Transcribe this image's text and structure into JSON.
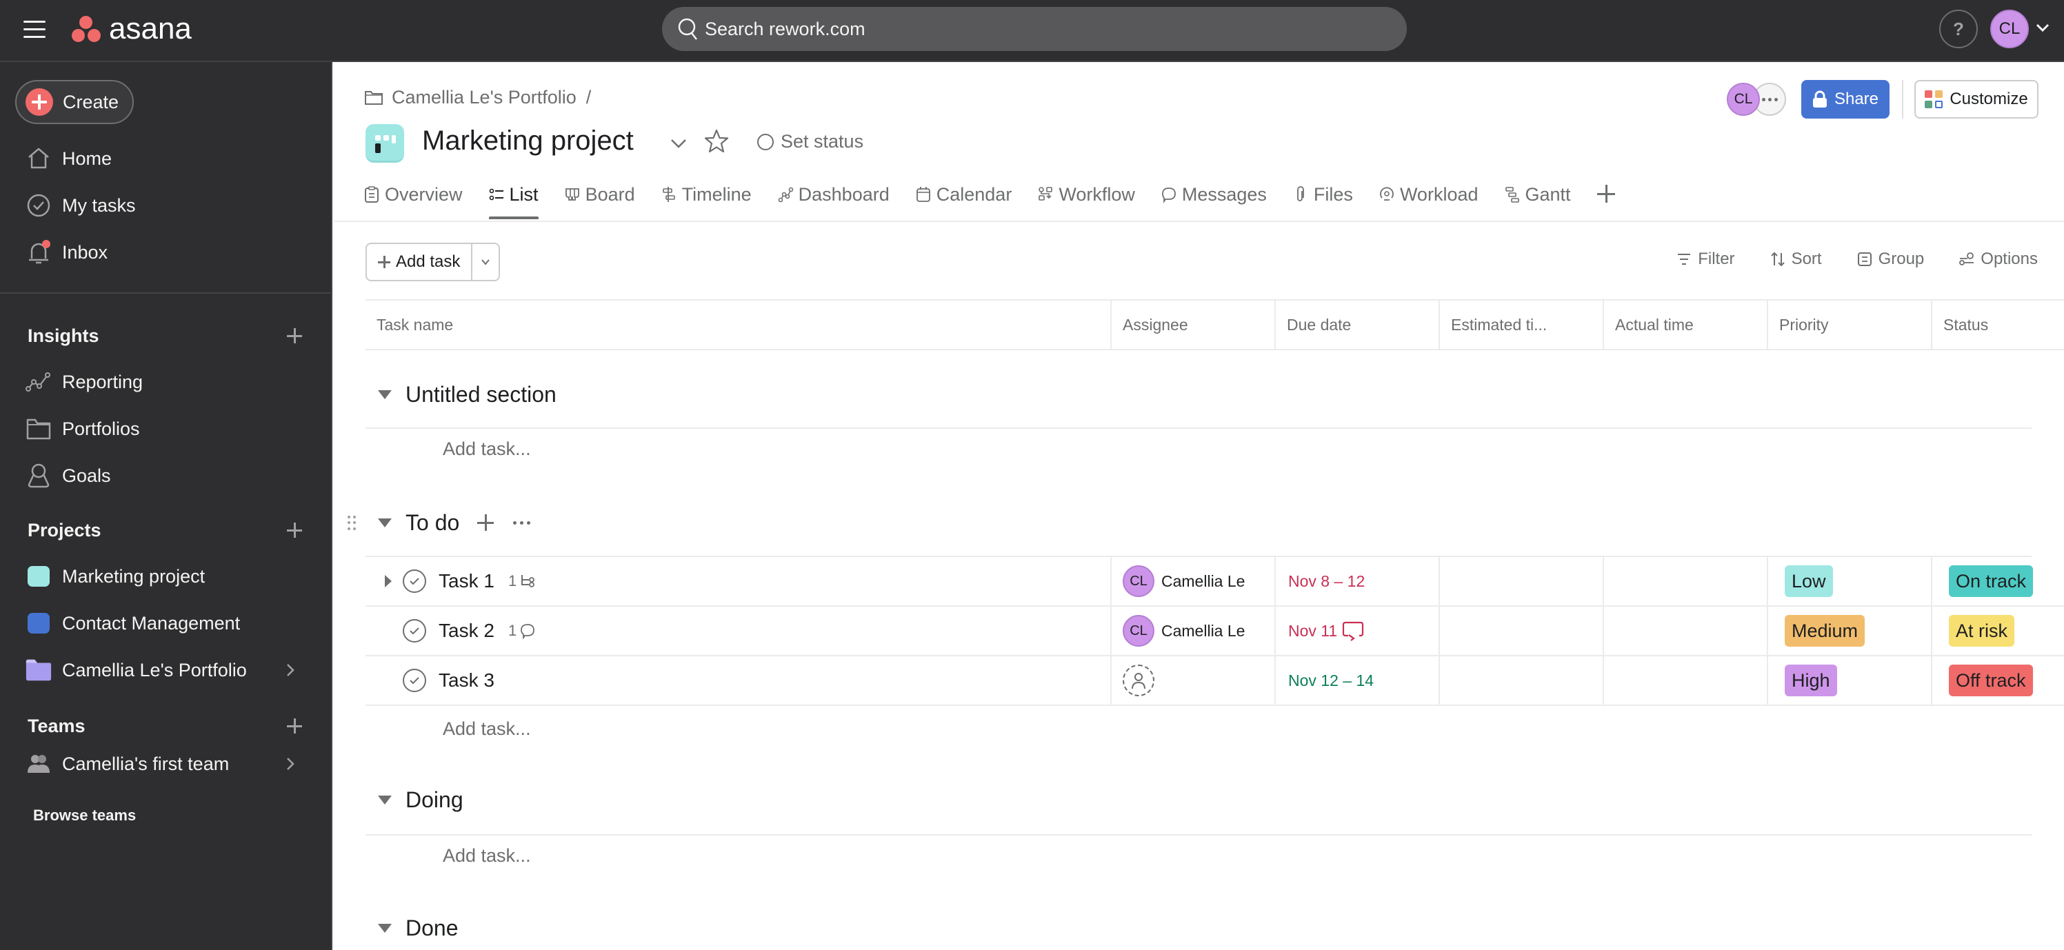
{
  "topbar": {
    "brand": "asana",
    "search_placeholder": "Search rework.com",
    "help_label": "?",
    "user_initials": "CL"
  },
  "sidebar": {
    "create_label": "Create",
    "primary": [
      {
        "label": "Home",
        "icon": "home-icon"
      },
      {
        "label": "My tasks",
        "icon": "check-circle-icon"
      },
      {
        "label": "Inbox",
        "icon": "bell-icon",
        "has_notification": true
      }
    ],
    "insights": {
      "heading": "Insights",
      "items": [
        {
          "label": "Reporting",
          "icon": "chart-line-icon"
        },
        {
          "label": "Portfolios",
          "icon": "folder-icon"
        },
        {
          "label": "Goals",
          "icon": "goal-icon"
        }
      ]
    },
    "projects": {
      "heading": "Projects",
      "items": [
        {
          "label": "Marketing project",
          "color": "#9ee7e3"
        },
        {
          "label": "Contact Management",
          "color": "#4573d2"
        },
        {
          "label": "Camellia Le's Portfolio",
          "color": "#a89cf0",
          "type": "portfolio"
        }
      ]
    },
    "teams": {
      "heading": "Teams",
      "items": [
        {
          "label": "Camellia's first team"
        }
      ],
      "browse_label": "Browse teams"
    }
  },
  "header": {
    "breadcrumb": "Camellia Le's Portfolio",
    "breadcrumb_sep": "/",
    "project_title": "Marketing project",
    "set_status_label": "Set status",
    "member_initials": "CL",
    "share_label": "Share",
    "customize_label": "Customize",
    "tabs": [
      {
        "label": "Overview",
        "icon": "clipboard-icon"
      },
      {
        "label": "List",
        "icon": "list-icon",
        "active": true
      },
      {
        "label": "Board",
        "icon": "board-icon"
      },
      {
        "label": "Timeline",
        "icon": "timeline-icon"
      },
      {
        "label": "Dashboard",
        "icon": "dashboard-icon"
      },
      {
        "label": "Calendar",
        "icon": "calendar-icon"
      },
      {
        "label": "Workflow",
        "icon": "workflow-icon"
      },
      {
        "label": "Messages",
        "icon": "message-icon"
      },
      {
        "label": "Files",
        "icon": "paperclip-icon"
      },
      {
        "label": "Workload",
        "icon": "workload-icon"
      },
      {
        "label": "Gantt",
        "icon": "gantt-icon"
      }
    ]
  },
  "toolbar": {
    "add_task_label": "Add task",
    "filter_label": "Filter",
    "sort_label": "Sort",
    "group_label": "Group",
    "options_label": "Options"
  },
  "table": {
    "columns": [
      "Task name",
      "Assignee",
      "Due date",
      "Estimated ti...",
      "Actual time",
      "Priority",
      "Status"
    ],
    "add_task_placeholder": "Add task...",
    "sections": [
      {
        "title": "Untitled section",
        "tasks": []
      },
      {
        "title": "To do",
        "tasks": [
          {
            "name": "Task 1",
            "meta_count": "1",
            "meta_icon": "subtask-icon",
            "has_subtasks": true,
            "assignee_initials": "CL",
            "assignee": "Camellia Le",
            "due": "Nov 8 – 12",
            "due_color": "#c92f54",
            "estimated": "",
            "actual": "",
            "priority": "Low",
            "priority_color": "#9ee7e3",
            "status": "On track",
            "status_color": "#4ecbc4"
          },
          {
            "name": "Task 2",
            "meta_count": "1",
            "meta_icon": "comment-icon",
            "assignee_initials": "CL",
            "assignee": "Camellia Le",
            "due": "Nov 11",
            "due_color": "#c92f54",
            "due_recurring": true,
            "estimated": "",
            "actual": "",
            "priority": "Medium",
            "priority_color": "#f1bd6c",
            "status": "At risk",
            "status_color": "#f8df72"
          },
          {
            "name": "Task 3",
            "meta_count": "",
            "meta_icon": "",
            "assignee_initials": "",
            "assignee": "",
            "due": "Nov 12 – 14",
            "due_color": "#0d7f56",
            "estimated": "",
            "actual": "",
            "priority": "High",
            "priority_color": "#cd95ea",
            "status": "Off track",
            "status_color": "#f06a6a"
          }
        ]
      },
      {
        "title": "Doing",
        "tasks": []
      },
      {
        "title": "Done",
        "tasks": []
      }
    ]
  }
}
